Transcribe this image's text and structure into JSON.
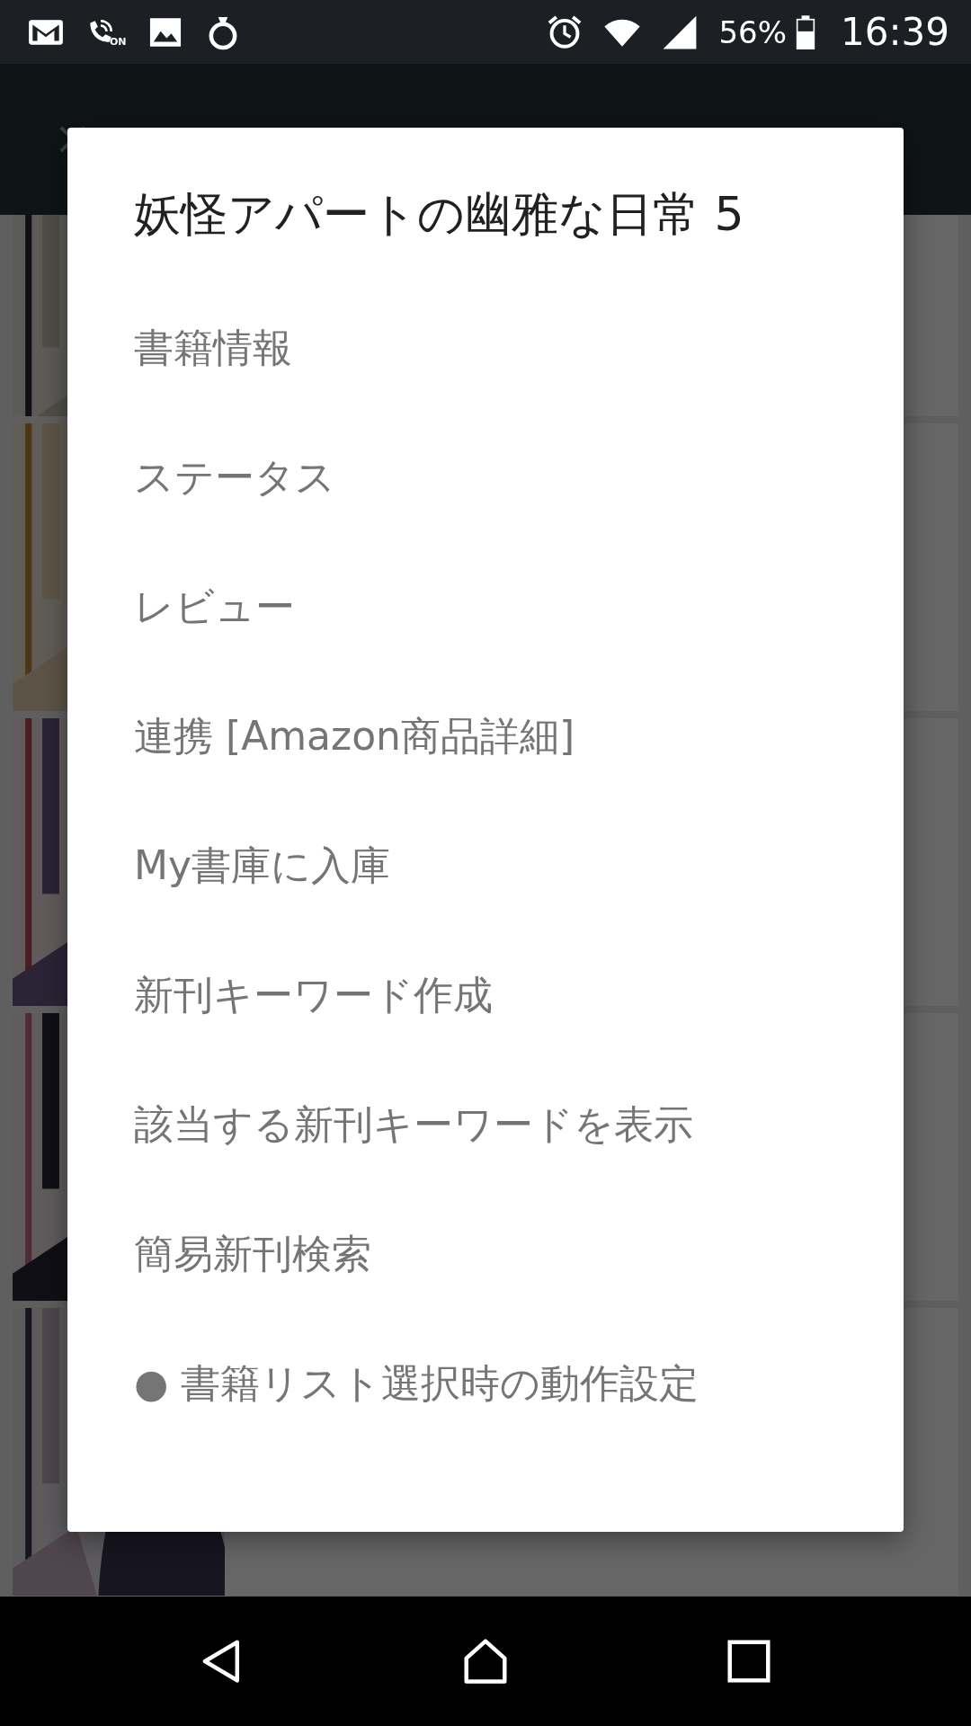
{
  "status_bar": {
    "call_badge": "ON",
    "battery": "56%",
    "time": "16:39"
  },
  "dialog": {
    "title": "妖怪アパートの幽雅な日常 5",
    "items": [
      {
        "label": "書籍情報"
      },
      {
        "label": "ステータス"
      },
      {
        "label": "レビュー"
      },
      {
        "label": "連携 [Amazon商品詳細]"
      },
      {
        "label": "My書庫に入庫"
      },
      {
        "label": "新刊キーワード作成"
      },
      {
        "label": "該当する新刊キーワードを表示"
      },
      {
        "label": "簡易新刊検索"
      },
      {
        "label": "● 書籍リスト選択時の動作設定"
      }
    ]
  }
}
